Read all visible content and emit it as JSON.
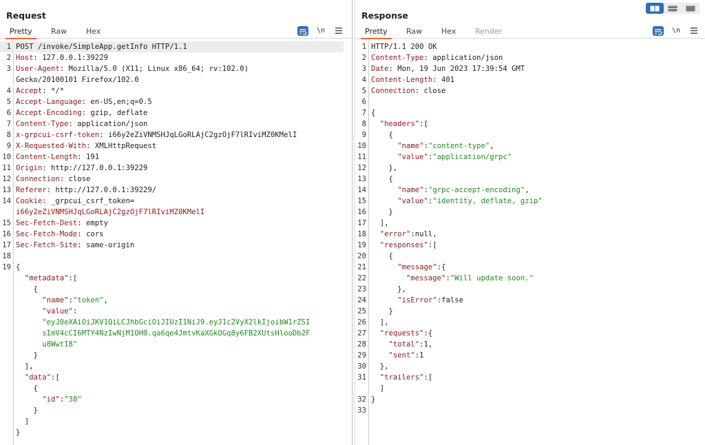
{
  "view_toggle": {
    "options": [
      "side-by-side",
      "horizontal",
      "vertical"
    ],
    "active": "side-by-side"
  },
  "request": {
    "title": "Request",
    "tabs": [
      "Pretty",
      "Raw",
      "Hex"
    ],
    "active_tab": "Pretty",
    "toolbar": {
      "newline_label": "\\n"
    },
    "lines": [
      {
        "n": "1",
        "segs": [
          [
            "t",
            "POST /invoke/SimpleApp.getInfo HTTP/1.1"
          ]
        ]
      },
      {
        "n": "2",
        "segs": [
          [
            "k",
            "Host"
          ],
          [
            "t",
            ": 127.0.0.1:39229"
          ]
        ]
      },
      {
        "n": "3",
        "segs": [
          [
            "k",
            "User-Agent"
          ],
          [
            "t",
            ": Mozilla/5.0 (X11; Linux x86_64; rv:102.0)"
          ]
        ]
      },
      {
        "n": "",
        "segs": [
          [
            "t",
            "Gecko/20100101 Firefox/102.0"
          ]
        ]
      },
      {
        "n": "4",
        "segs": [
          [
            "k",
            "Accept"
          ],
          [
            "t",
            ": */*"
          ]
        ]
      },
      {
        "n": "5",
        "segs": [
          [
            "k",
            "Accept-Language"
          ],
          [
            "t",
            ": en-US,en;q=0.5"
          ]
        ]
      },
      {
        "n": "6",
        "segs": [
          [
            "k",
            "Accept-Encoding"
          ],
          [
            "t",
            ": gzip, deflate"
          ]
        ]
      },
      {
        "n": "7",
        "segs": [
          [
            "k",
            "Content-Type"
          ],
          [
            "t",
            ": application/json"
          ]
        ]
      },
      {
        "n": "8",
        "segs": [
          [
            "k",
            "x-grpcui-csrf-token"
          ],
          [
            "t",
            ": i66y2eZiVNMSHJqLGoRLAjC2gzOjF7lRIviMZ0KMelI"
          ]
        ]
      },
      {
        "n": "9",
        "segs": [
          [
            "k",
            "X-Requested-With"
          ],
          [
            "t",
            ": XMLHttpRequest"
          ]
        ]
      },
      {
        "n": "10",
        "segs": [
          [
            "k",
            "Content-Length"
          ],
          [
            "t",
            ": 191"
          ]
        ]
      },
      {
        "n": "11",
        "segs": [
          [
            "k",
            "Origin"
          ],
          [
            "t",
            ": http://127.0.0.1:39229"
          ]
        ]
      },
      {
        "n": "12",
        "segs": [
          [
            "k",
            "Connection"
          ],
          [
            "t",
            ": close"
          ]
        ]
      },
      {
        "n": "13",
        "segs": [
          [
            "k",
            "Referer"
          ],
          [
            "t",
            ": http://127.0.0.1:39229/"
          ]
        ]
      },
      {
        "n": "14",
        "segs": [
          [
            "k",
            "Cookie"
          ],
          [
            "t",
            ": _grpcui_csrf_token="
          ]
        ]
      },
      {
        "n": "",
        "segs": [
          [
            "v",
            "i66y2eZiVNMSHJqLGoRLAjC2gzOjF7lRIviMZ0KMelI"
          ]
        ]
      },
      {
        "n": "15",
        "segs": [
          [
            "k",
            "Sec-Fetch-Dest"
          ],
          [
            "t",
            ": empty"
          ]
        ]
      },
      {
        "n": "16",
        "segs": [
          [
            "k",
            "Sec-Fetch-Mode"
          ],
          [
            "t",
            ": cors"
          ]
        ]
      },
      {
        "n": "17",
        "segs": [
          [
            "k",
            "Sec-Fetch-Site"
          ],
          [
            "t",
            ": same-origin"
          ]
        ]
      },
      {
        "n": "18",
        "segs": []
      },
      {
        "n": "19",
        "segs": [
          [
            "t",
            "{"
          ]
        ]
      },
      {
        "n": "",
        "segs": [
          [
            "t",
            "  "
          ],
          [
            "k",
            "\"metadata\""
          ],
          [
            "t",
            ":["
          ]
        ]
      },
      {
        "n": "",
        "segs": [
          [
            "t",
            "    {"
          ]
        ]
      },
      {
        "n": "",
        "segs": [
          [
            "t",
            "      "
          ],
          [
            "k",
            "\"name\""
          ],
          [
            "t",
            ":"
          ],
          [
            "s",
            "\"token\""
          ],
          [
            "t",
            ","
          ]
        ]
      },
      {
        "n": "",
        "segs": [
          [
            "t",
            "      "
          ],
          [
            "k",
            "\"value\""
          ],
          [
            "t",
            ":"
          ]
        ]
      },
      {
        "n": "",
        "segs": [
          [
            "t",
            "      "
          ],
          [
            "s",
            "\"eyJ0eXAiOiJKV1QiLCJhbGciOiJIUzI1NiJ9.eyJ1c2VyX2lkIjoibW1rZSI"
          ]
        ]
      },
      {
        "n": "",
        "segs": [
          [
            "t",
            "      "
          ],
          [
            "s",
            "sImV4cCI6MTY4NzIwNjM1OH0.qa6qe4JmtvKaXGkOGq8y6FB2XUtsHlooDb2F"
          ]
        ]
      },
      {
        "n": "",
        "segs": [
          [
            "t",
            "      "
          ],
          [
            "s",
            "u8Wwt18\""
          ]
        ]
      },
      {
        "n": "",
        "segs": [
          [
            "t",
            "    }"
          ]
        ]
      },
      {
        "n": "",
        "segs": [
          [
            "t",
            "  ],"
          ]
        ]
      },
      {
        "n": "",
        "segs": [
          [
            "t",
            "  "
          ],
          [
            "k",
            "\"data\""
          ],
          [
            "t",
            ":["
          ]
        ]
      },
      {
        "n": "",
        "segs": [
          [
            "t",
            "    {"
          ]
        ]
      },
      {
        "n": "",
        "segs": [
          [
            "t",
            "      "
          ],
          [
            "k",
            "\"id\""
          ],
          [
            "t",
            ":"
          ],
          [
            "s",
            "\"38\""
          ]
        ]
      },
      {
        "n": "",
        "segs": [
          [
            "t",
            "    }"
          ]
        ]
      },
      {
        "n": "",
        "segs": [
          [
            "t",
            "  ]"
          ]
        ]
      },
      {
        "n": "",
        "segs": [
          [
            "t",
            "}"
          ]
        ]
      }
    ]
  },
  "response": {
    "title": "Response",
    "tabs": [
      "Pretty",
      "Raw",
      "Hex",
      "Render"
    ],
    "active_tab": "Pretty",
    "toolbar": {
      "newline_label": "\\n"
    },
    "lines": [
      {
        "n": "1",
        "segs": [
          [
            "t",
            "HTTP/1.1 200 OK"
          ]
        ]
      },
      {
        "n": "2",
        "segs": [
          [
            "k",
            "Content-Type"
          ],
          [
            "t",
            ": application/json"
          ]
        ]
      },
      {
        "n": "3",
        "segs": [
          [
            "k",
            "Date"
          ],
          [
            "t",
            ": Mon, 19 Jun 2023 17:39:54 GMT"
          ]
        ]
      },
      {
        "n": "4",
        "segs": [
          [
            "k",
            "Content-Length"
          ],
          [
            "t",
            ": 401"
          ]
        ]
      },
      {
        "n": "5",
        "segs": [
          [
            "k",
            "Connection"
          ],
          [
            "t",
            ": close"
          ]
        ]
      },
      {
        "n": "6",
        "segs": []
      },
      {
        "n": "7",
        "segs": [
          [
            "t",
            "{"
          ]
        ]
      },
      {
        "n": "8",
        "segs": [
          [
            "t",
            "  "
          ],
          [
            "k",
            "\"headers\""
          ],
          [
            "t",
            ":["
          ]
        ]
      },
      {
        "n": "9",
        "segs": [
          [
            "t",
            "    {"
          ]
        ]
      },
      {
        "n": "10",
        "segs": [
          [
            "t",
            "      "
          ],
          [
            "k",
            "\"name\""
          ],
          [
            "t",
            ":"
          ],
          [
            "s",
            "\"content-type\""
          ],
          [
            "t",
            ","
          ]
        ]
      },
      {
        "n": "11",
        "segs": [
          [
            "t",
            "      "
          ],
          [
            "k",
            "\"value\""
          ],
          [
            "t",
            ":"
          ],
          [
            "s",
            "\"application/grpc\""
          ]
        ]
      },
      {
        "n": "12",
        "segs": [
          [
            "t",
            "    },"
          ]
        ]
      },
      {
        "n": "13",
        "segs": [
          [
            "t",
            "    {"
          ]
        ]
      },
      {
        "n": "14",
        "segs": [
          [
            "t",
            "      "
          ],
          [
            "k",
            "\"name\""
          ],
          [
            "t",
            ":"
          ],
          [
            "s",
            "\"grpc-accept-encoding\""
          ],
          [
            "t",
            ","
          ]
        ]
      },
      {
        "n": "15",
        "segs": [
          [
            "t",
            "      "
          ],
          [
            "k",
            "\"value\""
          ],
          [
            "t",
            ":"
          ],
          [
            "s",
            "\"identity, deflate, gzip\""
          ]
        ]
      },
      {
        "n": "16",
        "segs": [
          [
            "t",
            "    }"
          ]
        ]
      },
      {
        "n": "17",
        "segs": [
          [
            "t",
            "  ],"
          ]
        ]
      },
      {
        "n": "18",
        "segs": [
          [
            "t",
            "  "
          ],
          [
            "k",
            "\"error\""
          ],
          [
            "t",
            ":null,"
          ]
        ]
      },
      {
        "n": "19",
        "segs": [
          [
            "t",
            "  "
          ],
          [
            "k",
            "\"responses\""
          ],
          [
            "t",
            ":["
          ]
        ]
      },
      {
        "n": "20",
        "segs": [
          [
            "t",
            "    {"
          ]
        ]
      },
      {
        "n": "21",
        "segs": [
          [
            "t",
            "      "
          ],
          [
            "k",
            "\"message\""
          ],
          [
            "t",
            ":{"
          ]
        ]
      },
      {
        "n": "22",
        "segs": [
          [
            "t",
            "        "
          ],
          [
            "k",
            "\"message\""
          ],
          [
            "t",
            ":"
          ],
          [
            "s",
            "\"Will update soon.\""
          ]
        ]
      },
      {
        "n": "23",
        "segs": [
          [
            "t",
            "      },"
          ]
        ]
      },
      {
        "n": "24",
        "segs": [
          [
            "t",
            "      "
          ],
          [
            "k",
            "\"isError\""
          ],
          [
            "t",
            ":false"
          ]
        ]
      },
      {
        "n": "25",
        "segs": [
          [
            "t",
            "    }"
          ]
        ]
      },
      {
        "n": "26",
        "segs": [
          [
            "t",
            "  ],"
          ]
        ]
      },
      {
        "n": "27",
        "segs": [
          [
            "t",
            "  "
          ],
          [
            "k",
            "\"requests\""
          ],
          [
            "t",
            ":{"
          ]
        ]
      },
      {
        "n": "28",
        "segs": [
          [
            "t",
            "    "
          ],
          [
            "k",
            "\"total\""
          ],
          [
            "t",
            ":1,"
          ]
        ]
      },
      {
        "n": "29",
        "segs": [
          [
            "t",
            "    "
          ],
          [
            "k",
            "\"sent\""
          ],
          [
            "t",
            ":1"
          ]
        ]
      },
      {
        "n": "30",
        "segs": [
          [
            "t",
            "  },"
          ]
        ]
      },
      {
        "n": "31",
        "segs": [
          [
            "t",
            "  "
          ],
          [
            "k",
            "\"trailers\""
          ],
          [
            "t",
            ":["
          ]
        ]
      },
      {
        "n": "",
        "segs": [
          [
            "t",
            "  ]"
          ]
        ]
      },
      {
        "n": "32",
        "segs": [
          [
            "t",
            "}"
          ]
        ]
      },
      {
        "n": "33",
        "segs": []
      }
    ]
  }
}
